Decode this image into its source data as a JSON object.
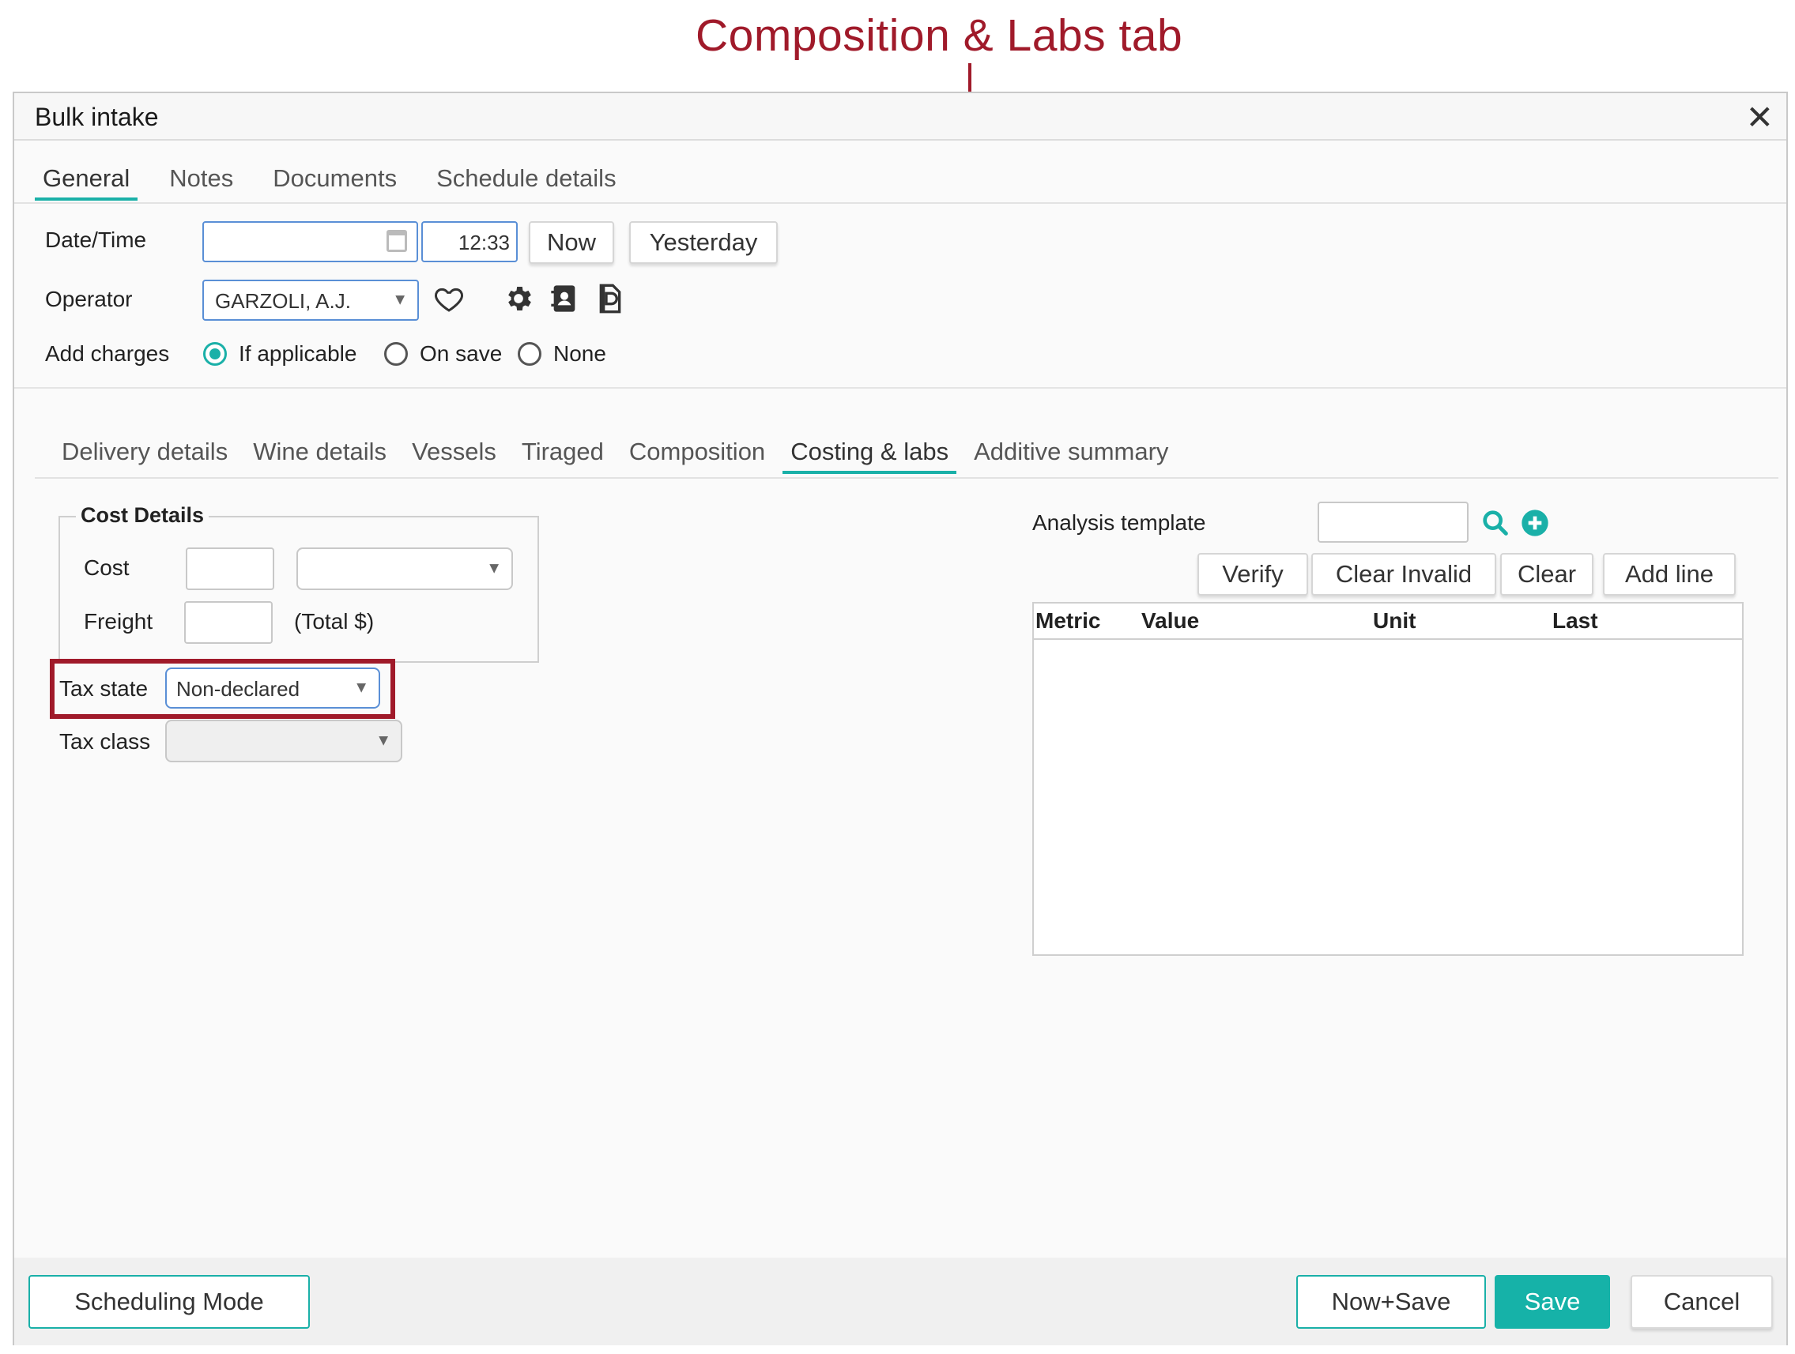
{
  "annotation": {
    "title": "Composition & Labs tab"
  },
  "dialog": {
    "title": "Bulk intake"
  },
  "top_tabs": [
    "General",
    "Notes",
    "Documents",
    "Schedule details"
  ],
  "form": {
    "datetime_label": "Date/Time",
    "date_value": "",
    "time_value": "12:33",
    "now_label": "Now",
    "yesterday_label": "Yesterday",
    "operator_label": "Operator",
    "operator_value": "GARZOLI, A.J.",
    "add_charges_label": "Add charges",
    "charge_options": [
      "If applicable",
      "On save",
      "None"
    ],
    "charge_selected": "If applicable"
  },
  "sub_tabs": [
    "Delivery details",
    "Wine details",
    "Vessels",
    "Tiraged",
    "Composition",
    "Costing & labs",
    "Additive summary"
  ],
  "sub_tab_active": "Costing & labs",
  "cost": {
    "legend": "Cost Details",
    "cost_label": "Cost",
    "cost_value": "",
    "cost_unit_value": "",
    "freight_label": "Freight",
    "freight_value": "",
    "freight_suffix": "(Total $)",
    "tax_state_label": "Tax state",
    "tax_state_value": "Non-declared",
    "tax_class_label": "Tax class",
    "tax_class_value": ""
  },
  "analysis": {
    "template_label": "Analysis template",
    "template_value": "",
    "verify_label": "Verify",
    "clear_invalid_label": "Clear Invalid",
    "clear_label": "Clear",
    "add_line_label": "Add line",
    "columns": [
      "Metric",
      "Value",
      "Unit",
      "Last"
    ]
  },
  "footer": {
    "scheduling_label": "Scheduling Mode",
    "now_save_label": "Now+Save",
    "save_label": "Save",
    "cancel_label": "Cancel"
  },
  "colors": {
    "accent": "#1ab0a8",
    "annotation": "#a01a2a",
    "input_focus": "#5a8fd6"
  },
  "icons": [
    "calendar-icon",
    "heart-icon",
    "gear-icon",
    "contact-card-icon",
    "document-icon",
    "search-icon",
    "plus-circle-icon",
    "close-icon",
    "chevron-down-icon"
  ]
}
